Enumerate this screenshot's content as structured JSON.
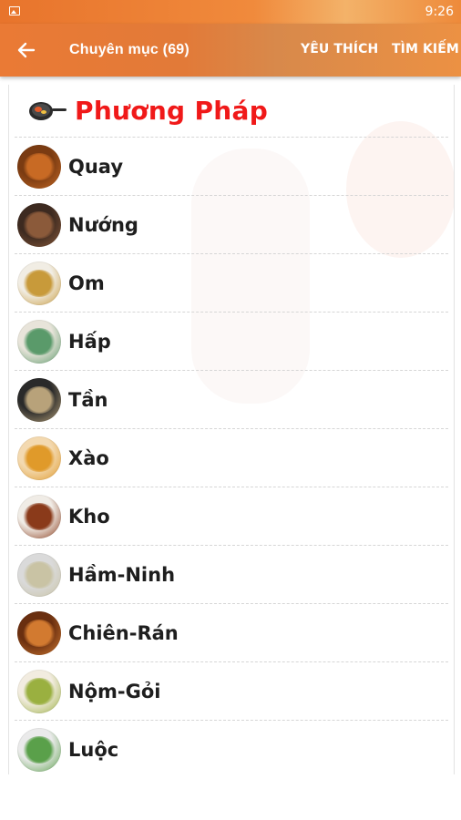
{
  "status_bar": {
    "time": "9:26",
    "notification_icon": "image-icon"
  },
  "toolbar": {
    "back_icon": "arrow-left-icon",
    "title": "Chuyên mục (69)",
    "favorites_label": "YÊU THÍCH",
    "search_label": "TÌM KIẾM"
  },
  "section": {
    "icon": "pan-icon",
    "title": "Phương Pháp",
    "title_color": "#f01919"
  },
  "items": [
    {
      "label": "Quay",
      "thumb": [
        "#7a3b12",
        "#c86a24"
      ]
    },
    {
      "label": "Nướng",
      "thumb": [
        "#3d2a20",
        "#8b5a3a"
      ]
    },
    {
      "label": "Om",
      "thumb": [
        "#f1ede4",
        "#c89a3a"
      ]
    },
    {
      "label": "Hấp",
      "thumb": [
        "#e8e4da",
        "#5a9a6a"
      ]
    },
    {
      "label": "Tần",
      "thumb": [
        "#2a2a2a",
        "#b8a27a"
      ]
    },
    {
      "label": "Xào",
      "thumb": [
        "#f3d9b0",
        "#e09a2a"
      ]
    },
    {
      "label": "Kho",
      "thumb": [
        "#f0ece6",
        "#8a3a1a"
      ]
    },
    {
      "label": "Hầm-Ninh",
      "thumb": [
        "#dadada",
        "#c9c3a4"
      ]
    },
    {
      "label": "Chiên-Rán",
      "thumb": [
        "#6a2f10",
        "#d27a30"
      ]
    },
    {
      "label": "Nộm-Gỏi",
      "thumb": [
        "#f2ece0",
        "#9ab040"
      ]
    },
    {
      "label": "Luộc",
      "thumb": [
        "#eaeaea",
        "#5aa04a"
      ]
    }
  ],
  "colors": {
    "toolbar": "#e27a38",
    "title_red": "#f01919"
  }
}
